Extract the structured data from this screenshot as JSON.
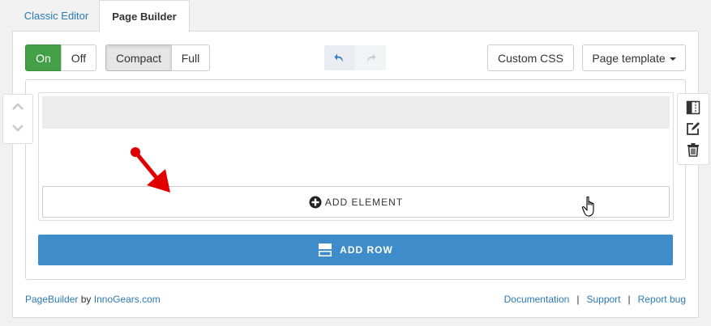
{
  "tabs": {
    "classic": "Classic Editor",
    "builder": "Page Builder"
  },
  "toolbar": {
    "on_label": "On",
    "off_label": "Off",
    "compact_label": "Compact",
    "full_label": "Full",
    "custom_css_label": "Custom CSS",
    "page_template_label": "Page template"
  },
  "row": {
    "add_element_label": "ADD ELEMENT"
  },
  "main": {
    "add_row_label": "ADD ROW"
  },
  "footer": {
    "product": "PageBuilder",
    "by": "by",
    "vendor": "InnoGears.com",
    "links": [
      "Documentation",
      "Support",
      "Report bug"
    ],
    "separator": "|"
  },
  "colors": {
    "active_green": "#43a047",
    "primary_blue": "#3f8ccb",
    "link_blue": "#2a7ab5",
    "arrow_red": "#e00000"
  },
  "icons": [
    "undo-icon",
    "redo-icon",
    "move-up-icon",
    "move-down-icon",
    "columns-icon",
    "edit-icon",
    "trash-icon",
    "plus-circle-icon",
    "row-icon",
    "annotation-arrow",
    "hand-cursor-icon"
  ]
}
